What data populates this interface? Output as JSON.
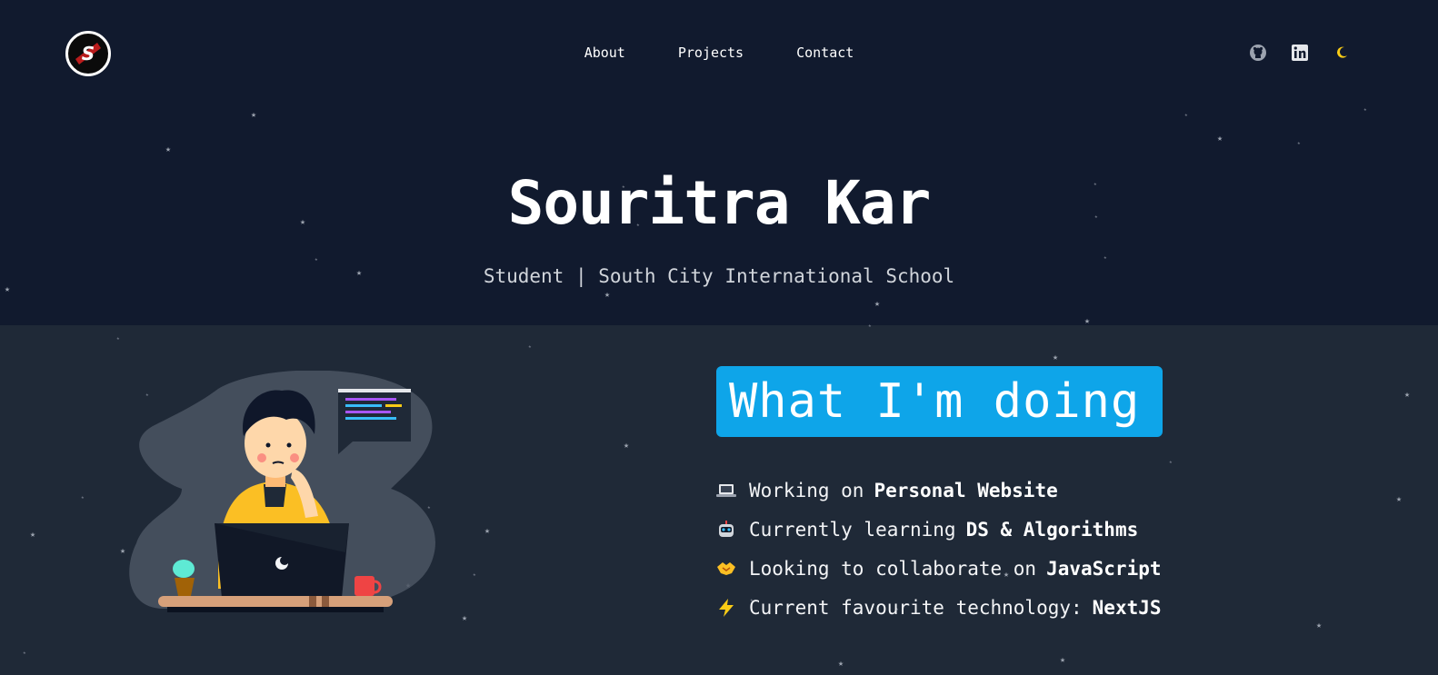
{
  "header": {
    "logo_letter": "S",
    "nav": [
      {
        "label": "About"
      },
      {
        "label": "Projects"
      },
      {
        "label": "Contact"
      }
    ],
    "social_icons": [
      "github-icon",
      "linkedin-icon",
      "moon-icon"
    ]
  },
  "hero": {
    "name": "Souritra Kar",
    "subtitle": "Student | South City International School"
  },
  "doing": {
    "heading": "What I'm doing",
    "items": [
      {
        "emoji": "laptop-icon",
        "text": "Working on",
        "highlight": "Personal Website"
      },
      {
        "emoji": "robot-icon",
        "text": "Currently learning",
        "highlight": "DS & Algorithms"
      },
      {
        "emoji": "handshake-icon",
        "text": "Looking to collaborate on",
        "highlight": "JavaScript"
      },
      {
        "emoji": "lightning-icon",
        "text": "Current favourite technology:",
        "highlight": "NextJS"
      }
    ]
  },
  "colors": {
    "hero_bg": "#111a2e",
    "section_bg": "#1f2937",
    "accent": "#0ea5e9",
    "moon": "#facc15"
  }
}
